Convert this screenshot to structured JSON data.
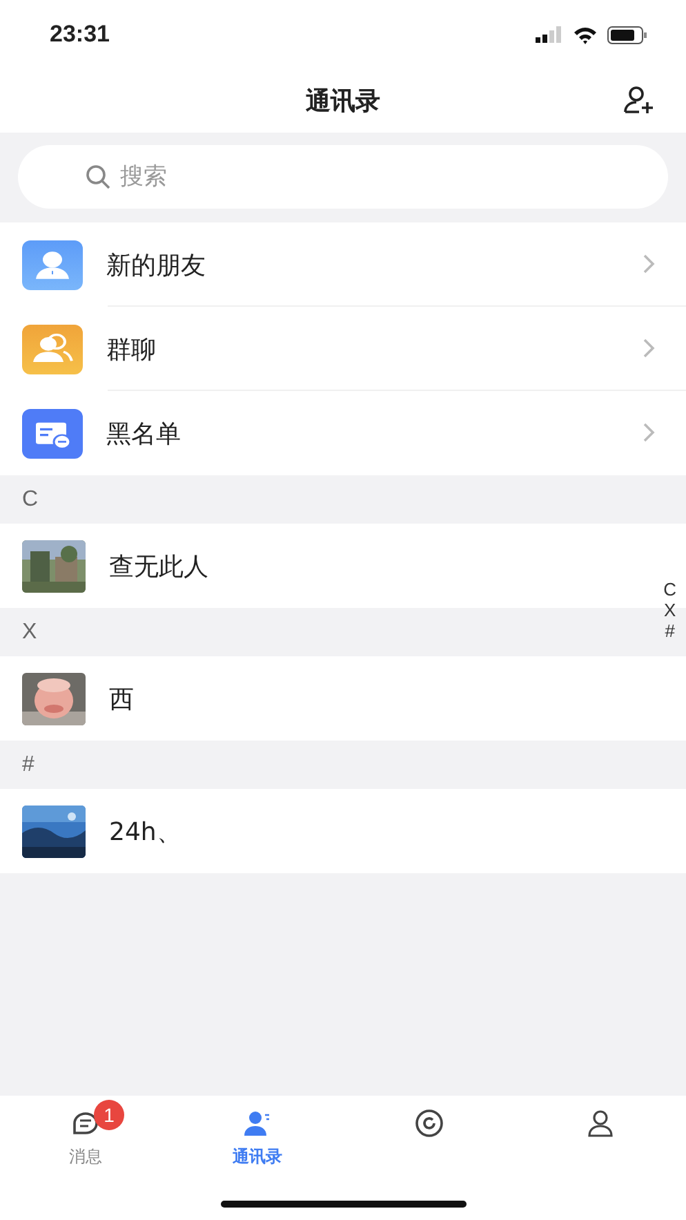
{
  "status_bar": {
    "time": "23:31"
  },
  "nav": {
    "title": "通讯录"
  },
  "search": {
    "placeholder": "搜索"
  },
  "shortcuts": [
    {
      "label": "新的朋友",
      "kind": "new-friends"
    },
    {
      "label": "群聊",
      "kind": "group-chat"
    },
    {
      "label": "黑名单",
      "kind": "blacklist"
    }
  ],
  "sections": [
    {
      "letter": "C",
      "contacts": [
        {
          "name": "查无此人"
        }
      ]
    },
    {
      "letter": "X",
      "contacts": [
        {
          "name": "西"
        }
      ]
    },
    {
      "letter": "#",
      "contacts": [
        {
          "name": "24h、"
        }
      ]
    }
  ],
  "index_bar": [
    "C",
    "X",
    "#"
  ],
  "tabs": [
    {
      "label": "消息",
      "selected": false,
      "badge": "1",
      "kind": "chat"
    },
    {
      "label": "通讯录",
      "selected": true,
      "kind": "contacts"
    },
    {
      "selected": false,
      "kind": "discover"
    },
    {
      "selected": false,
      "kind": "me"
    }
  ]
}
